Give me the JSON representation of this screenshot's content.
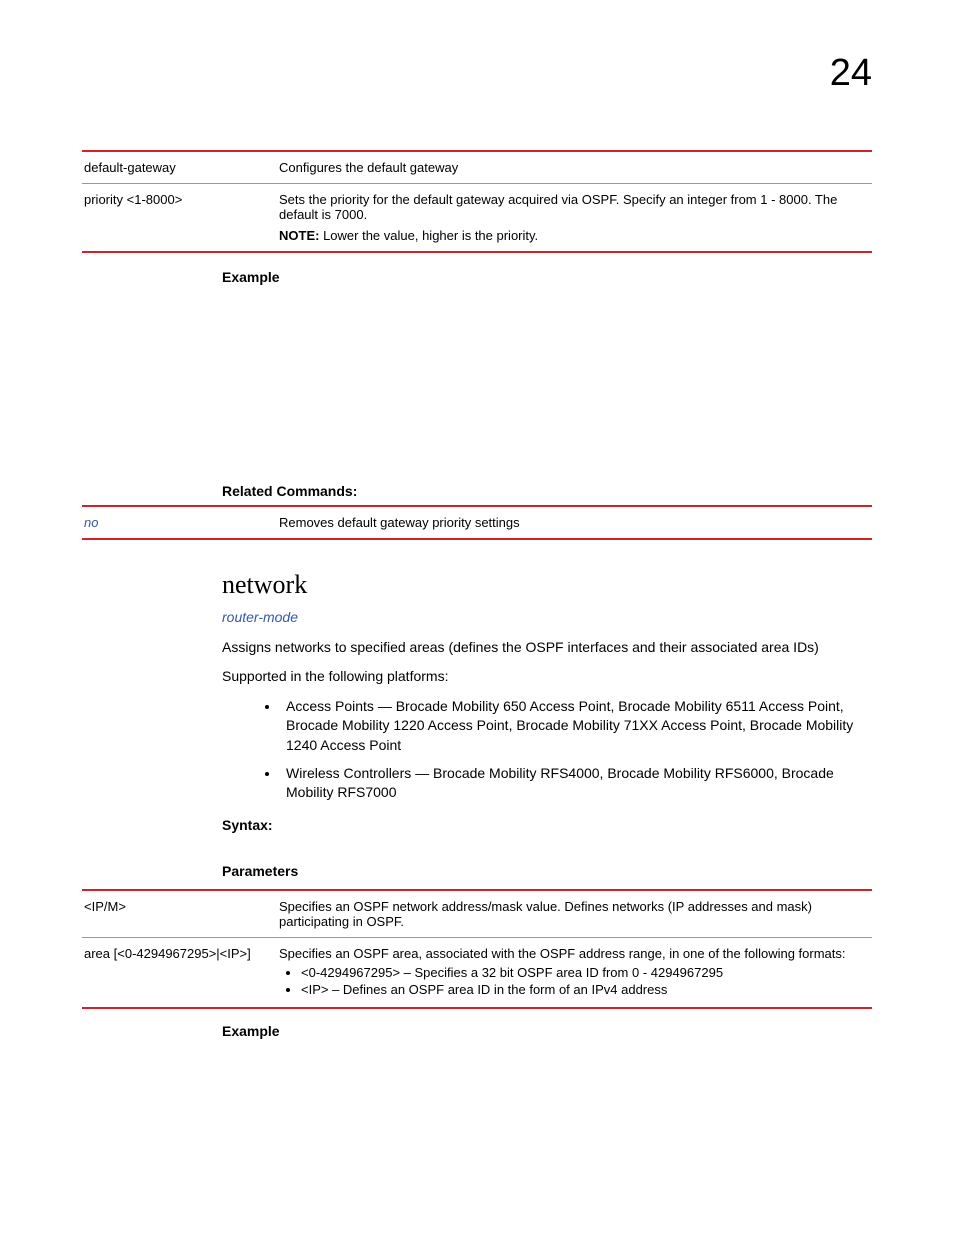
{
  "pageNumber": "24",
  "table1": {
    "row1": {
      "key": "default-gateway",
      "desc": "Configures the default gateway"
    },
    "row2": {
      "key": "priority <1-8000>",
      "desc": "Sets the priority for the default gateway acquired via OSPF. Specify an integer from 1 - 8000. The default is 7000.",
      "noteLabel": "NOTE:",
      "noteText": "  Lower the value, higher is the priority."
    }
  },
  "labels": {
    "example": "Example",
    "related": "Related Commands:",
    "syntax": "Syntax:",
    "parameters": "Parameters"
  },
  "relatedTable": {
    "row1": {
      "key": "no",
      "desc": "Removes default gateway priority settings"
    }
  },
  "section": {
    "heading": "network",
    "subhead": "router-mode",
    "para1": "Assigns networks to specified areas (defines the OSPF interfaces and their associated area IDs)",
    "para2": "Supported in the following platforms:",
    "bullets": {
      "b1": "Access Points — Brocade Mobility 650 Access Point, Brocade Mobility 6511 Access Point, Brocade Mobility 1220 Access Point, Brocade Mobility 71XX Access Point, Brocade Mobility 1240 Access Point",
      "b2": "Wireless Controllers — Brocade Mobility RFS4000, Brocade Mobility RFS6000, Brocade Mobility RFS7000"
    }
  },
  "table2": {
    "row1": {
      "key": "<IP/M>",
      "desc": "Specifies an OSPF network address/mask value. Defines networks (IP addresses and mask) participating in OSPF."
    },
    "row2": {
      "key": "area [<0-4294967295>|<IP>]",
      "desc": "Specifies an OSPF area, associated with the OSPF address range, in one of the following formats:",
      "sub1": "<0-4294967295> – Specifies a 32 bit OSPF area ID from 0 - 4294967295",
      "sub2": "<IP> – Defines an OSPF area ID in the form of an IPv4 address"
    }
  }
}
